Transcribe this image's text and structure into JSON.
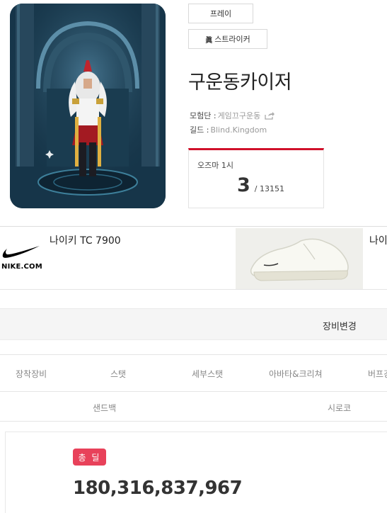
{
  "character": {
    "job": "프레이",
    "sub_job_badge": "眞",
    "sub_job": "스트라이커",
    "name": "구운동카이저",
    "adventure_label": "모험단 :",
    "adventure_value": "게임끄구운동",
    "guild_label": "길드 :",
    "guild_value": "Blind.Kingdom"
  },
  "rank": {
    "label": "오즈마 1시",
    "value": "3",
    "total": "/ 13151"
  },
  "ad": {
    "brand": "NIKE.COM",
    "title_1": "나이키 TC 7900",
    "title_2": "나이"
  },
  "equip": {
    "change_label": "장비변경"
  },
  "tabs": [
    "장착장비",
    "스탯",
    "세부스탯",
    "아바타&크리쳐",
    "버프강"
  ],
  "subtabs": [
    "샌드백",
    "시로코"
  ],
  "total": {
    "badge": "총 딜",
    "amount": "180,316,837,967"
  },
  "colors": {
    "accent_red": "#d0112b",
    "badge_red": "#e8415a"
  }
}
